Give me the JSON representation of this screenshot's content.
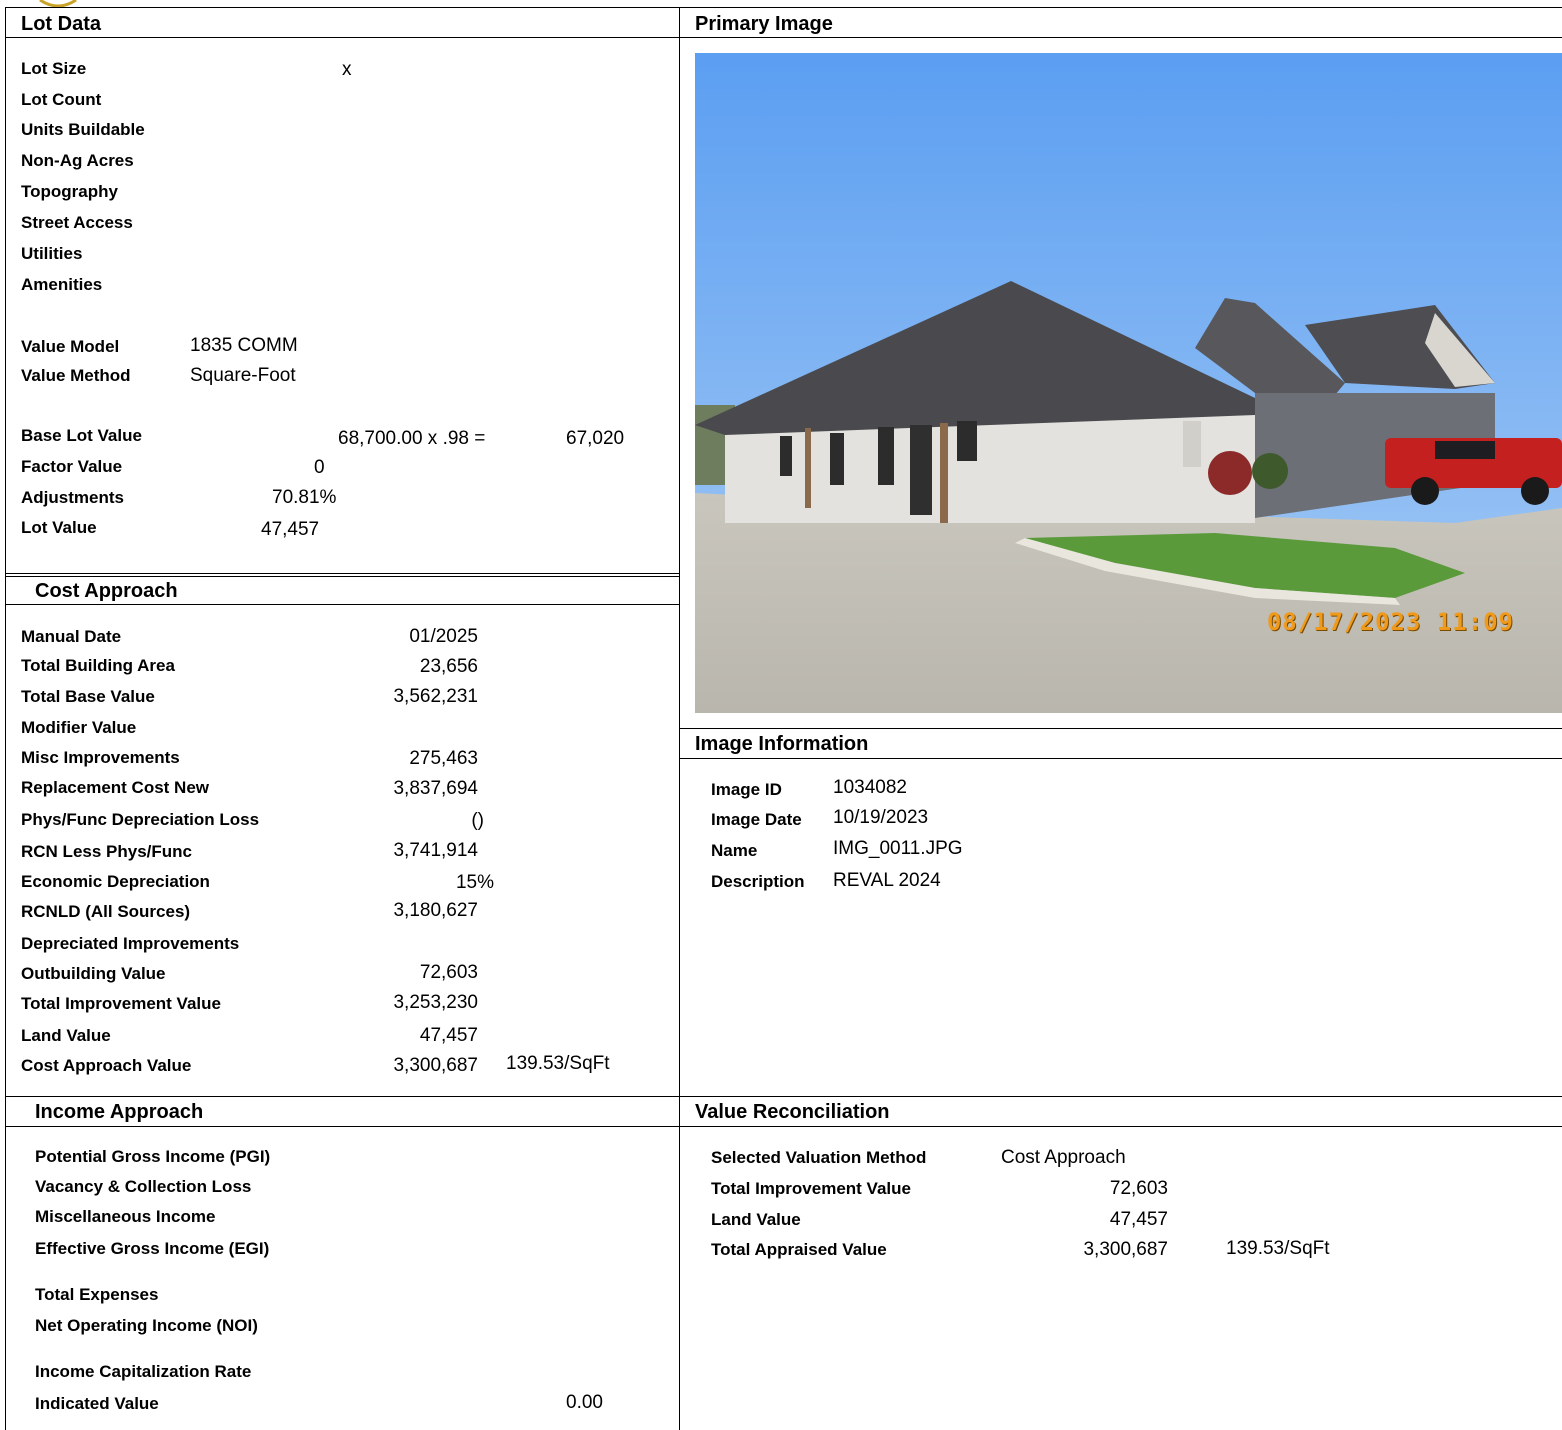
{
  "lot_data": {
    "header": "Lot Data",
    "lot_size_label": "Lot Size",
    "lot_size_value": "x",
    "lot_count_label": "Lot Count",
    "units_buildable_label": "Units Buildable",
    "non_ag_acres_label": "Non-Ag Acres",
    "topography_label": "Topography",
    "street_access_label": "Street Access",
    "utilities_label": "Utilities",
    "amenities_label": "Amenities",
    "value_model_label": "Value Model",
    "value_model_value": "1835 COMM",
    "value_method_label": "Value Method",
    "value_method_value": "Square-Foot",
    "base_lot_value_label": "Base Lot Value",
    "base_lot_formula": "68,700.00 x .98 =",
    "base_lot_result": "67,020",
    "factor_value_label": "Factor Value",
    "factor_value_value": "0",
    "adjustments_label": "Adjustments",
    "adjustments_value": "70.81%",
    "lot_value_label": "Lot Value",
    "lot_value_value": "47,457"
  },
  "cost_approach": {
    "header": "Cost Approach",
    "rows": [
      {
        "label": "Manual Date",
        "value": "01/2025"
      },
      {
        "label": "Total Building Area",
        "value": "23,656"
      },
      {
        "label": "Total Base Value",
        "value": "3,562,231"
      },
      {
        "label": "Modifier Value",
        "value": ""
      },
      {
        "label": "Misc Improvements",
        "value": "275,463"
      },
      {
        "label": "Replacement Cost New",
        "value": "3,837,694"
      },
      {
        "label": "Phys/Func Depreciation Loss",
        "value": "()"
      },
      {
        "label": "RCN Less Phys/Func",
        "value": "3,741,914"
      },
      {
        "label": "Economic Depreciation",
        "value": "15%"
      },
      {
        "label": "RCNLD (All Sources)",
        "value": "3,180,627"
      },
      {
        "label": "Depreciated Improvements",
        "value": ""
      },
      {
        "label": "Outbuilding Value",
        "value": "72,603"
      },
      {
        "label": "Total Improvement Value",
        "value": "3,253,230"
      },
      {
        "label": "Land Value",
        "value": "47,457"
      },
      {
        "label": "Cost Approach Value",
        "value": "3,300,687"
      }
    ],
    "per_sqft": "139.53/SqFt"
  },
  "income_approach": {
    "header": "Income Approach",
    "pgi_label": "Potential Gross Income (PGI)",
    "vacancy_label": "Vacancy & Collection Loss",
    "misc_income_label": "Miscellaneous Income",
    "egi_label": "Effective Gross Income (EGI)",
    "total_expenses_label": "Total Expenses",
    "noi_label": "Net Operating Income (NOI)",
    "cap_rate_label": "Income Capitalization Rate",
    "indicated_value_label": "Indicated Value",
    "indicated_value_value": "0.00"
  },
  "primary_image": {
    "header": "Primary Image",
    "timestamp": "08/17/2023 11:09"
  },
  "image_information": {
    "header": "Image Information",
    "image_id_label": "Image ID",
    "image_id_value": "1034082",
    "image_date_label": "Image Date",
    "image_date_value": "10/19/2023",
    "name_label": "Name",
    "name_value": "IMG_0011.JPG",
    "description_label": "Description",
    "description_value": "REVAL 2024"
  },
  "value_reconciliation": {
    "header": "Value Reconciliation",
    "method_label": "Selected Valuation Method",
    "method_value": "Cost Approach",
    "total_improvement_label": "Total Improvement Value",
    "total_improvement_value": "72,603",
    "land_value_label": "Land Value",
    "land_value_value": "47,457",
    "total_appraised_label": "Total Appraised Value",
    "total_appraised_value": "3,300,687",
    "per_sqft": "139.53/SqFt"
  }
}
